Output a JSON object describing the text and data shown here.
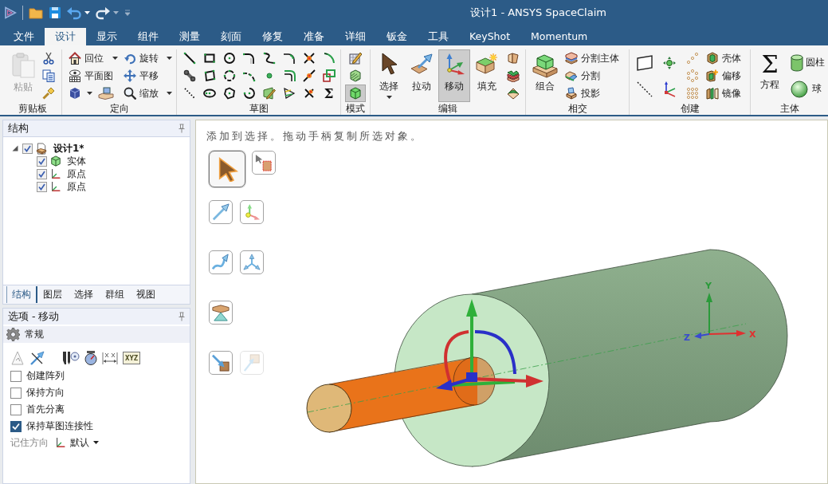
{
  "window": {
    "title": "设计1 - ANSYS SpaceClaim"
  },
  "ribbon_tabs": [
    {
      "label": "文件",
      "selected": false
    },
    {
      "label": "设计",
      "selected": true
    },
    {
      "label": "显示",
      "selected": false
    },
    {
      "label": "组件",
      "selected": false
    },
    {
      "label": "测量",
      "selected": false
    },
    {
      "label": "刻面",
      "selected": false
    },
    {
      "label": "修复",
      "selected": false
    },
    {
      "label": "准备",
      "selected": false
    },
    {
      "label": "详细",
      "selected": false
    },
    {
      "label": "钣金",
      "selected": false
    },
    {
      "label": "工具",
      "selected": false
    },
    {
      "label": "KeyShot",
      "selected": false
    },
    {
      "label": "Momentum",
      "selected": false
    }
  ],
  "ribbon_groups": [
    {
      "kind": "clipboard",
      "title": "剪贴板",
      "buttons": [
        {
          "label": "粘贴",
          "disabled": true
        }
      ]
    },
    {
      "kind": "orient",
      "title": "定向",
      "buttons": [
        {
          "label": "回位",
          "dropdown": true
        },
        {
          "label": "旋转",
          "dropdown": true
        },
        {
          "label": "平面图",
          "dropdown": false
        },
        {
          "label": "平移",
          "dropdown": false
        },
        {
          "label": "缩放",
          "dropdown": true
        }
      ]
    },
    {
      "kind": "sketch",
      "title": "草图",
      "symbol": "Σ"
    },
    {
      "kind": "mode",
      "title": "模式",
      "modes": [
        {
          "selected": false
        },
        {
          "selected": false
        },
        {
          "selected": true
        }
      ]
    },
    {
      "kind": "edit",
      "title": "编辑",
      "buttons": [
        {
          "label": "选择",
          "selected": false,
          "dropdown": true
        },
        {
          "label": "拉动",
          "selected": false,
          "dropdown": false
        },
        {
          "label": "移动",
          "selected": true,
          "dropdown": false
        },
        {
          "label": "填充",
          "selected": false,
          "dropdown": false
        }
      ]
    },
    {
      "kind": "intersect",
      "title": "相交",
      "buttons": [
        {
          "label": "组合"
        },
        {
          "label": "分割主体"
        },
        {
          "label": "分割"
        },
        {
          "label": "投影"
        }
      ]
    },
    {
      "kind": "create",
      "title": "创建",
      "buttons": [
        {
          "label": "壳体"
        },
        {
          "label": "偏移"
        },
        {
          "label": "镜像"
        }
      ]
    },
    {
      "kind": "body",
      "title": "主体",
      "symbol": "Σ",
      "buttons": [
        {
          "label": "方程"
        },
        {
          "label": "圆柱"
        },
        {
          "label": "球"
        }
      ]
    }
  ],
  "structure_panel": {
    "title": "结构",
    "tree": [
      {
        "kind": "design",
        "label": "设计1*",
        "checked": true,
        "expanded": true,
        "children": [
          {
            "kind": "body",
            "label": "实体",
            "checked": true
          },
          {
            "kind": "origin",
            "label": "原点",
            "checked": true
          },
          {
            "kind": "origin",
            "label": "原点",
            "checked": true
          }
        ]
      }
    ],
    "tabs": [
      {
        "label": "结构",
        "selected": true
      },
      {
        "label": "图层",
        "selected": false
      },
      {
        "label": "选择",
        "selected": false
      },
      {
        "label": "群组",
        "selected": false
      },
      {
        "label": "视图",
        "selected": false
      }
    ]
  },
  "options_panel": {
    "title": "选项 - 移动",
    "section": "常规",
    "coordinate_label": "XYZ",
    "checkboxes": [
      {
        "label": "创建阵列",
        "checked": false
      },
      {
        "label": "保持方向",
        "checked": false
      },
      {
        "label": "首先分离",
        "checked": false
      },
      {
        "label": "保持草图连接性",
        "checked": true
      }
    ],
    "orientation": {
      "label": "记住方向",
      "value": "默认"
    }
  },
  "viewport": {
    "hint": "添加到选择。拖动手柄复制所选对象。",
    "tools": [
      {
        "selected": true,
        "disabled": false
      },
      {
        "selected": false,
        "disabled": false
      },
      {
        "selected": false,
        "disabled": false
      },
      {
        "selected": false,
        "disabled": false
      },
      {
        "selected": false,
        "disabled": false
      },
      {
        "selected": false,
        "disabled": false
      },
      {
        "selected": false,
        "disabled": false
      },
      {
        "selected": false,
        "disabled": false
      },
      {
        "selected": false,
        "disabled": true
      }
    ],
    "axis_labels": {
      "x": "X",
      "y": "Y",
      "z": "Z"
    }
  }
}
